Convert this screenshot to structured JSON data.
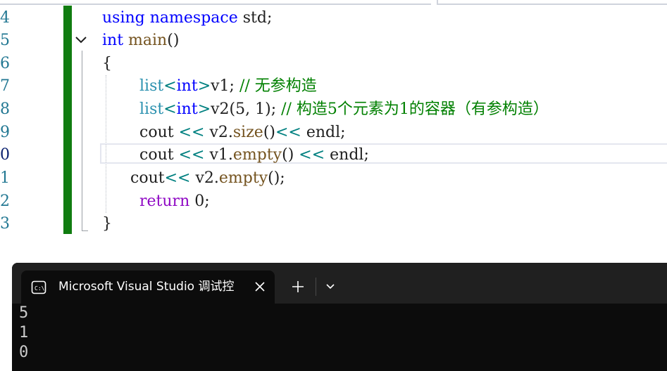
{
  "editor": {
    "lines": [
      {
        "num": "4",
        "tokens": [
          {
            "t": "using",
            "c": "kw"
          },
          {
            "t": " ",
            "c": "pl"
          },
          {
            "t": "namespace",
            "c": "kw"
          },
          {
            "t": " std;",
            "c": "pl"
          }
        ]
      },
      {
        "num": "5",
        "tokens": [
          {
            "t": "int",
            "c": "kw"
          },
          {
            "t": " ",
            "c": "pl"
          },
          {
            "t": "main",
            "c": "fn"
          },
          {
            "t": "()",
            "c": "pl"
          }
        ]
      },
      {
        "num": "6",
        "tokens": [
          {
            "t": "{",
            "c": "pl"
          }
        ]
      },
      {
        "num": "7",
        "tokens": [
          {
            "t": "list",
            "c": "ty"
          },
          {
            "t": "<",
            "c": "op"
          },
          {
            "t": "int",
            "c": "kw"
          },
          {
            "t": ">",
            "c": "op"
          },
          {
            "t": "v1; ",
            "c": "pl"
          },
          {
            "t": "// 无参构造",
            "c": "cm"
          }
        ]
      },
      {
        "num": "8",
        "tokens": [
          {
            "t": "list",
            "c": "ty"
          },
          {
            "t": "<",
            "c": "op"
          },
          {
            "t": "int",
            "c": "kw"
          },
          {
            "t": ">",
            "c": "op"
          },
          {
            "t": "v2(5, 1); ",
            "c": "pl"
          },
          {
            "t": "// 构造5个元素为1的容器（有参构造）",
            "c": "cm"
          }
        ]
      },
      {
        "num": "9",
        "tokens": [
          {
            "t": "cout ",
            "c": "pl"
          },
          {
            "t": "<<",
            "c": "op"
          },
          {
            "t": " v2.",
            "c": "pl"
          },
          {
            "t": "size",
            "c": "fn"
          },
          {
            "t": "()",
            "c": "pl"
          },
          {
            "t": "<<",
            "c": "op"
          },
          {
            "t": " endl;",
            "c": "pl"
          }
        ]
      },
      {
        "num": "0",
        "active": true,
        "tokens": [
          {
            "t": "cout ",
            "c": "pl"
          },
          {
            "t": "<<",
            "c": "op"
          },
          {
            "t": " v1.",
            "c": "pl"
          },
          {
            "t": "empty",
            "c": "fn"
          },
          {
            "t": "() ",
            "c": "pl"
          },
          {
            "t": "<<",
            "c": "op"
          },
          {
            "t": " endl;",
            "c": "pl"
          }
        ]
      },
      {
        "num": "1",
        "tokens": [
          {
            "t": "cout",
            "c": "pl"
          },
          {
            "t": "<<",
            "c": "op"
          },
          {
            "t": " v2.",
            "c": "pl"
          },
          {
            "t": "empty",
            "c": "fn"
          },
          {
            "t": "();",
            "c": "pl"
          }
        ]
      },
      {
        "num": "2",
        "tokens": [
          {
            "t": "return",
            "c": "ctl"
          },
          {
            "t": " 0;",
            "c": "pl"
          }
        ]
      },
      {
        "num": "3",
        "tokens": [
          {
            "t": "}",
            "c": "pl"
          }
        ]
      }
    ]
  },
  "terminal": {
    "tab_title": "Microsoft Visual Studio 调试控",
    "tab_icon": "console-icon",
    "output": [
      "5",
      "1",
      "0"
    ]
  },
  "colors": {
    "change_bar": "#107c10",
    "keyword": "#0000ff",
    "type": "#2b91af",
    "comment": "#008000",
    "terminal_bg": "#0c0c0c"
  }
}
